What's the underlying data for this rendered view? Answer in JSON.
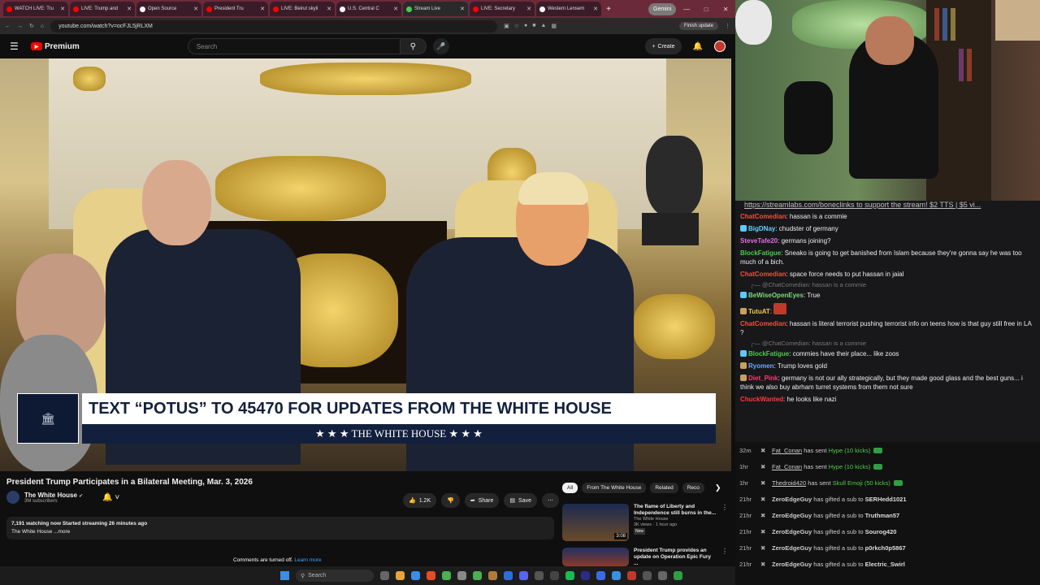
{
  "tabs": [
    {
      "label": "WATCH LIVE: Tru",
      "color": "#ff0000"
    },
    {
      "label": "LIVE: Trump and",
      "color": "#ff0000"
    },
    {
      "label": "Open Source",
      "color": "#ffffff"
    },
    {
      "label": "President Tru",
      "color": "#ff0000"
    },
    {
      "label": "LIVE: Beirut skyli",
      "color": "#ff0000"
    },
    {
      "label": "U.S. Central C",
      "color": "#ffffff"
    },
    {
      "label": "Stream Live",
      "color": "#4ecb4e"
    },
    {
      "label": "LIVE: Secretary",
      "color": "#ff0000"
    },
    {
      "label": "Western Lensem",
      "color": "#ffffff"
    }
  ],
  "gemini_label": "Gemini",
  "url": "youtube.com/watch?v=ocFJL5jRLXM",
  "finish_update": "Finish update",
  "youtube": {
    "logo_text": "Premium",
    "search_placeholder": "Search",
    "create_label": "Create",
    "caption_main": "TEXT “POTUS” TO 45470 FOR UPDATES FROM THE WHITE HOUSE",
    "caption_sub": "★ ★ ★   THE WHITE HOUSE   ★ ★ ★",
    "video_title": "President Trump Participates in a Bilateral Meeting, Mar. 3, 2026",
    "channel_name": "The White House",
    "subscribers": "3M subscribers",
    "likes": "1.2K",
    "share": "Share",
    "save": "Save",
    "desc_line1": "7,191 watching now  Started streaming 26 minutes ago",
    "desc_line2": "The White House ...more",
    "comments_off": "Comments are turned off.",
    "learn_more": "Learn more",
    "chips": [
      "All",
      "From The White House",
      "Related",
      "Reco"
    ],
    "recs": [
      {
        "title": "The flame of Liberty and Independence still burns in the...",
        "channel": "The White House",
        "meta": "3K views · 1 hour ago",
        "badge": "New",
        "duration": "3:08"
      },
      {
        "title": "President Trump provides an update on Operation Epic Fury ...",
        "channel": "",
        "meta": "",
        "badge": "",
        "duration": ""
      }
    ]
  },
  "chat": {
    "pinned_link": "https://streamlabs.com/boneclinks",
    "pinned_rest": " to support the stream! $2 TTS | $5 vi...",
    "messages": [
      {
        "user": "ChatComedian",
        "color": "#ff4a3a",
        "text": "hassan is a commie",
        "reply": ""
      },
      {
        "user": "BigDNay",
        "color": "#5fd3ff",
        "text": "chudster of germany",
        "reply": ""
      },
      {
        "user": "SteveTafe20",
        "color": "#e070e0",
        "text": "germans joining?",
        "reply": ""
      },
      {
        "user": "BlockFatigue",
        "color": "#4ecb4e",
        "text": "Sneako is going to get banished from Islam because they're gonna say he was too much of a bich.",
        "reply": ""
      },
      {
        "user": "ChatComedian",
        "color": "#ff4a3a",
        "text": "space force needs to put hassan in jaial",
        "reply": ""
      },
      {
        "user": "BeWiseOpenEyes",
        "color": "#7ddc7d",
        "text": "True",
        "reply": "@ChatComedian: hassan is a commie"
      },
      {
        "user": "TutuAT",
        "color": "#f2c94c",
        "text": "",
        "reply": ""
      },
      {
        "user": "ChatComedian",
        "color": "#ff4a3a",
        "text": "hassan is literal terrorist pushing terrorist info on teens how is that guy still free in LA ?",
        "reply": ""
      },
      {
        "user": "BlockFatigue",
        "color": "#4ecb4e",
        "text": "commies have their place... like zoos",
        "reply": "@ChatComedian: hassan is a commie"
      },
      {
        "user": "Ryomen",
        "color": "#6aa9ff",
        "text": "Trump loves gold",
        "reply": ""
      },
      {
        "user": "Diet_Pink",
        "color": "#ff3a6a",
        "text": "germany is not our ally strategically, but they made good glass and the best guns... i think we also buy abrham turret systems from them not sure",
        "reply": ""
      },
      {
        "user": "ChuckWanted",
        "color": "#ff3a3a",
        "text": "he looks like nazi",
        "reply": ""
      }
    ]
  },
  "events": [
    {
      "time": "32m",
      "name": "Fat_Conan",
      "action": " has sent ",
      "gift": "Hype (10 kicks)",
      "kick": true
    },
    {
      "time": "1hr",
      "name": "Fat_Conan",
      "action": " has sent ",
      "gift": "Hype (10 kicks)",
      "kick": true
    },
    {
      "time": "1hr",
      "name": "Thedroid420",
      "action": " has sent ",
      "gift": "Skull Emoji (50 kicks)",
      "kick": true
    },
    {
      "time": "21hr",
      "name": "ZeroEdgeGuy",
      "action": " has gifted a sub to ",
      "gift": "SERHedd1021",
      "kick": false
    },
    {
      "time": "21hr",
      "name": "ZeroEdgeGuy",
      "action": " has gifted a sub to ",
      "gift": "Truthman57",
      "kick": false
    },
    {
      "time": "21hr",
      "name": "ZeroEdgeGuy",
      "action": " has gifted a sub to ",
      "gift": "Sourog420",
      "kick": false
    },
    {
      "time": "21hr",
      "name": "ZeroEdgeGuy",
      "action": " has gifted a sub to ",
      "gift": "p0rkch0p5867",
      "kick": false
    },
    {
      "time": "21hr",
      "name": "ZeroEdgeGuy",
      "action": " has gifted a sub to ",
      "gift": "Electric_Swirl",
      "kick": false
    }
  ],
  "taskbar": {
    "search": "Search"
  }
}
